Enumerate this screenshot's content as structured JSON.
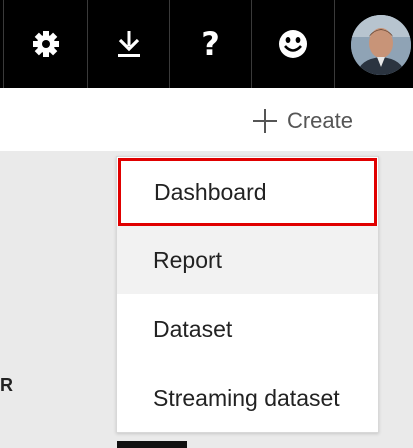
{
  "toolbar": {
    "icons": [
      "gear-icon",
      "download-icon",
      "help-icon",
      "smiley-icon"
    ],
    "help_glyph": "?",
    "avatar": "user-avatar"
  },
  "header": {
    "create_label": "Create"
  },
  "create_menu": {
    "items": [
      {
        "label": "Dashboard",
        "state": "selected"
      },
      {
        "label": "Report",
        "state": "hover"
      },
      {
        "label": "Dataset",
        "state": "normal"
      },
      {
        "label": "Streaming dataset",
        "state": "normal"
      }
    ]
  },
  "background": {
    "partial_text": "R"
  },
  "colors": {
    "topbar": "#000000",
    "highlight_border": "#e00000",
    "content_bg": "#eaeaea"
  }
}
